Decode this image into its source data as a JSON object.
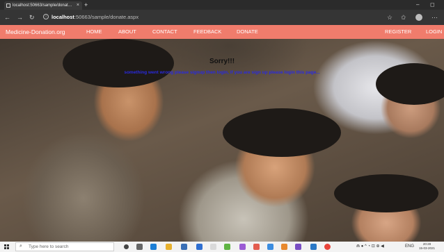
{
  "browser": {
    "tab_title": "localhost:50663/sample/donat…",
    "tab_close": "×",
    "new_tab": "+",
    "url_host": "localhost",
    "url_rest": ":50663/sample/donate.aspx",
    "window_controls": [
      "–",
      "◻"
    ]
  },
  "nav": {
    "brand": "Medicine-Donation.org",
    "links": [
      "HOME",
      "ABOUT",
      "CONTACT",
      "FEEDBACK",
      "DONATE"
    ],
    "right_links": [
      "REGISTER",
      "LOGIN"
    ]
  },
  "message": {
    "title": "Sorry!!!",
    "text": "something went wrong please signup then login, if you are sign up please login this page..."
  },
  "taskbar": {
    "search_placeholder": "Type here to search",
    "clock_time": "20:28",
    "clock_date": "15-03-2021",
    "lang": "ENG"
  },
  "colors": {
    "navbar": "#f07c6c",
    "message_text": "#2a2ae0"
  }
}
